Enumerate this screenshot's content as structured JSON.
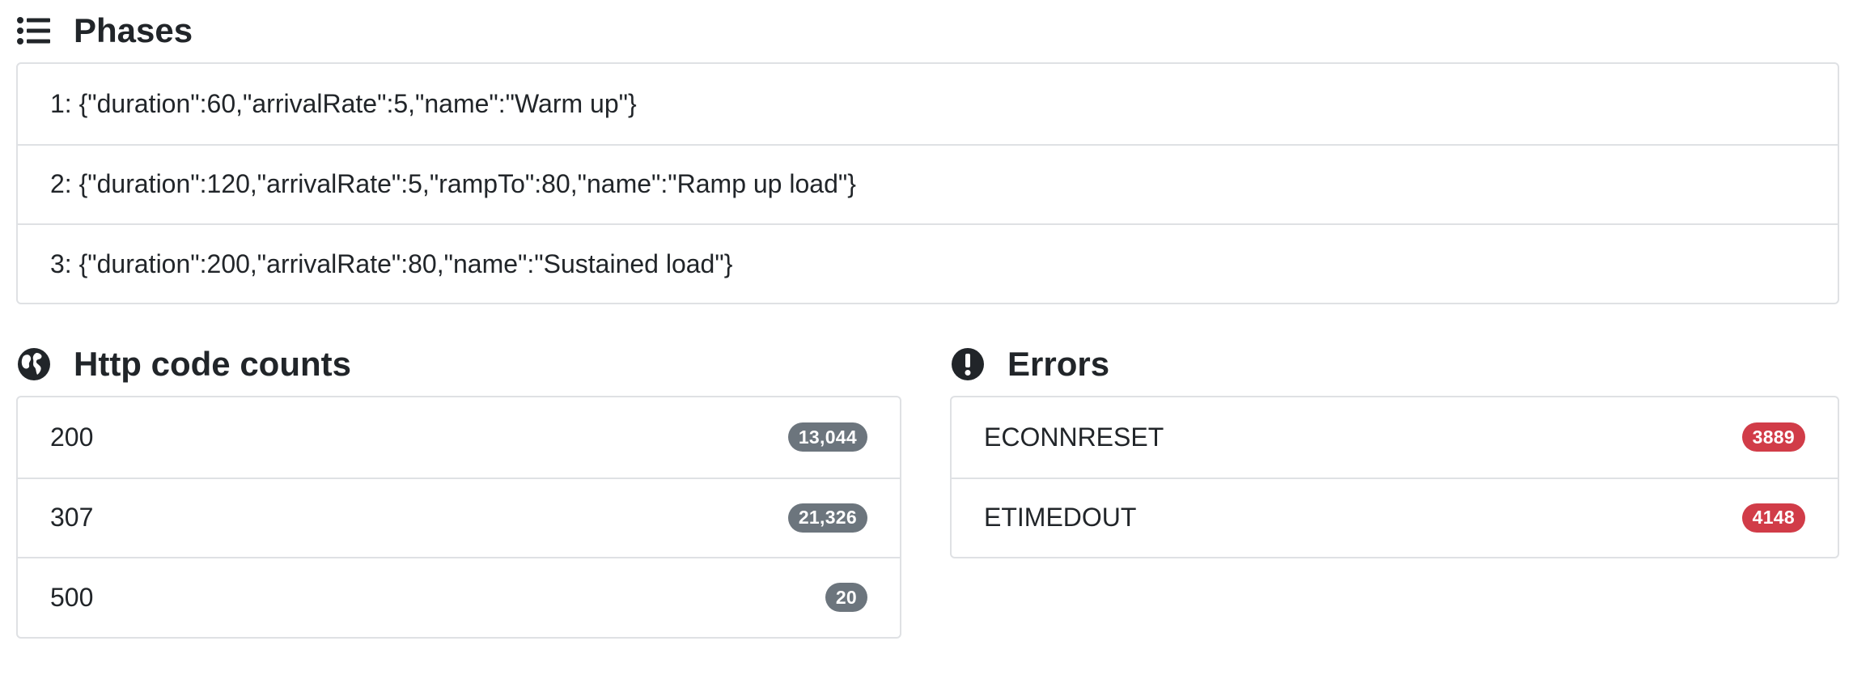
{
  "phases": {
    "title": "Phases",
    "icon": "list-icon",
    "items": [
      "1: {\"duration\":60,\"arrivalRate\":5,\"name\":\"Warm up\"}",
      "2: {\"duration\":120,\"arrivalRate\":5,\"rampTo\":80,\"name\":\"Ramp up load\"}",
      "3: {\"duration\":200,\"arrivalRate\":80,\"name\":\"Sustained load\"}"
    ]
  },
  "http_codes": {
    "title": "Http code counts",
    "icon": "globe-icon",
    "badge_color": "#6c757d",
    "items": [
      {
        "label": "200",
        "count": "13,044"
      },
      {
        "label": "307",
        "count": "21,326"
      },
      {
        "label": "500",
        "count": "20"
      }
    ]
  },
  "errors": {
    "title": "Errors",
    "icon": "exclamation-circle-icon",
    "badge_color": "#d13c48",
    "items": [
      {
        "label": "ECONNRESET",
        "count": "3889"
      },
      {
        "label": "ETIMEDOUT",
        "count": "4148"
      }
    ]
  }
}
